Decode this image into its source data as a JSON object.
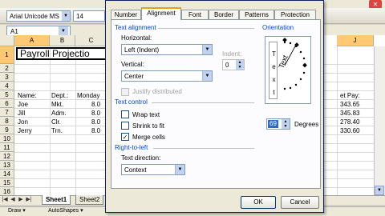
{
  "toolbar": {
    "font": "Arial Unicode MS",
    "size": "14"
  },
  "namebox": {
    "ref": "A1"
  },
  "columns": [
    "A",
    "B",
    "C",
    "J"
  ],
  "rows": [
    "1",
    "2",
    "3",
    "4",
    "5",
    "6",
    "7",
    "8",
    "9",
    "10",
    "11",
    "12",
    "13",
    "14",
    "15",
    "16",
    "17",
    "18"
  ],
  "spreadsheet": {
    "title": "Payroll Projectio",
    "headers": {
      "name": "Name:",
      "dept": "Dept.:",
      "monday": "Monday",
      "netpay": "et Pay:"
    },
    "data": [
      {
        "name": "Joe",
        "dept": "Mkt.",
        "monday": "8.0",
        "net": "343.65"
      },
      {
        "name": "Jill",
        "dept": "Adm.",
        "monday": "8.0",
        "net": "345.83"
      },
      {
        "name": "Jon",
        "dept": "Clr.",
        "monday": "8.0",
        "net": "278.40"
      },
      {
        "name": "Jerry",
        "dept": "Trn.",
        "monday": "8.0",
        "net": "330.60"
      }
    ]
  },
  "sheet_tabs": [
    "Sheet1",
    "Sheet2"
  ],
  "drawbar": {
    "draw": "Draw ▾",
    "autoshapes": "AutoShapes ▾"
  },
  "dialog": {
    "tabs": [
      "Number",
      "Alignment",
      "Font",
      "Border",
      "Patterns",
      "Protection"
    ],
    "active_tab": "Alignment",
    "text_alignment": {
      "section": "Text alignment",
      "horizontal_label": "Horizontal:",
      "horizontal_value": "Left (Indent)",
      "vertical_label": "Vertical:",
      "vertical_value": "Center",
      "indent_label": "Indent:",
      "indent_value": "0",
      "justify_distributed": "Justify distributed"
    },
    "text_control": {
      "section": "Text control",
      "wrap_text": "Wrap text",
      "shrink_to_fit": "Shrink to fit",
      "merge_cells": "Merge cells",
      "wrap_checked": false,
      "shrink_checked": false,
      "merge_checked": true
    },
    "rtl": {
      "section": "Right-to-left",
      "direction_label": "Text direction:",
      "direction_value": "Context"
    },
    "orientation": {
      "section": "Orientation",
      "vertical_text": [
        "T",
        "e",
        "x",
        "t"
      ],
      "rotated_text": "Text",
      "degrees_value": "69",
      "degrees_label": "Degrees"
    },
    "ok": "OK",
    "cancel": "Cancel"
  }
}
